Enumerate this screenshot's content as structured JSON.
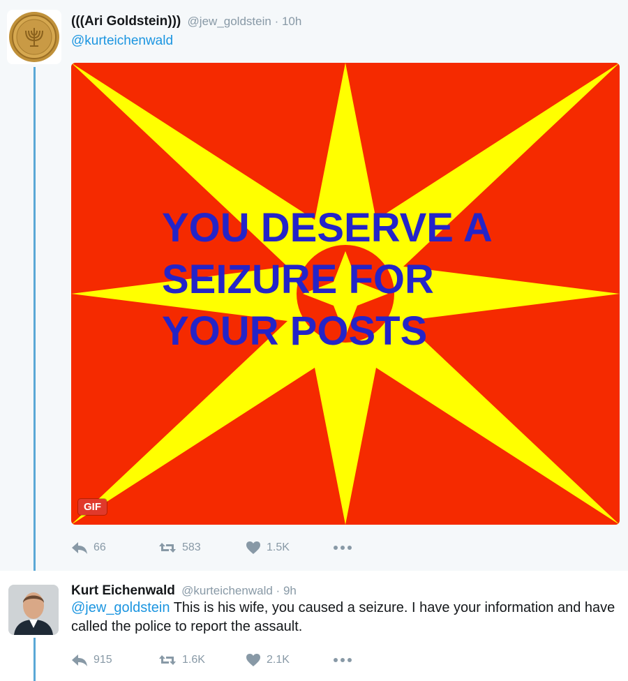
{
  "tweet1": {
    "display_name": "(((Ari Goldstein)))",
    "handle": "@jew_goldstein",
    "time": "10h",
    "reply_to": "@kurteichenwald",
    "gif_text_lines": [
      "YOU DESERVE A",
      "SEIZURE FOR",
      "YOUR POSTS"
    ],
    "gif_badge": "GIF",
    "replies": "66",
    "retweets": "583",
    "likes": "1.5K"
  },
  "tweet2": {
    "display_name": "Kurt Eichenwald",
    "handle": "@kurteichenwald",
    "time": "9h",
    "mention": "@jew_goldstein",
    "text": "This is his wife, you caused a seizure. I have your information and have called the police to report the assault.",
    "replies": "915",
    "retweets": "1.6K",
    "likes": "2.1K"
  },
  "separator": "·",
  "colors": {
    "gif_background": "#f52a00",
    "gif_star": "#ffff00",
    "gif_text": "#2424c8",
    "link": "#1b95e0",
    "action_gray": "#8899a6",
    "thread_line": "#5aa8d6"
  },
  "icons": [
    "reply-icon",
    "retweet-icon",
    "like-icon",
    "more-icon"
  ]
}
